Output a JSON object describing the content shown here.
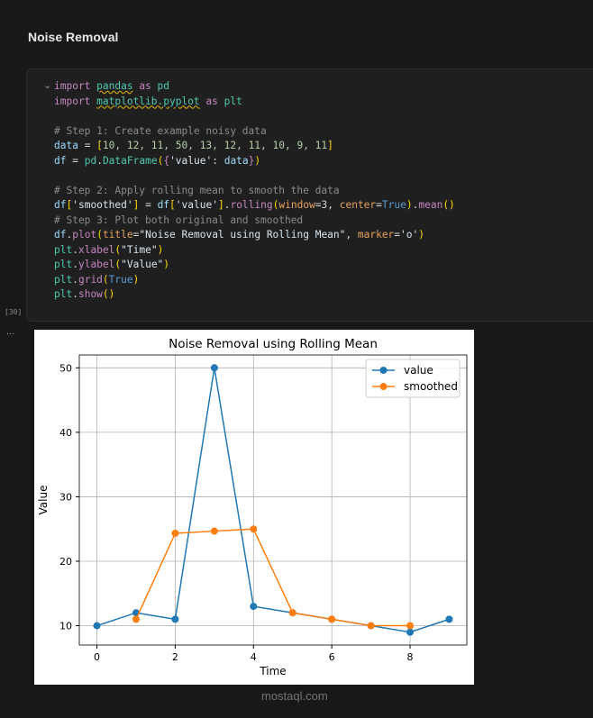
{
  "section_title": "Noise Removal",
  "cell": {
    "execution_count": "[30]",
    "output_prompt": "...",
    "code_lines": [
      [
        {
          "t": "import ",
          "k": "kw"
        },
        {
          "t": "pandas",
          "k": "mod sq"
        },
        {
          "t": " as ",
          "k": "kw"
        },
        {
          "t": "pd",
          "k": "mod"
        }
      ],
      [
        {
          "t": "import ",
          "k": "kw"
        },
        {
          "t": "matplotlib.pyplot",
          "k": "mod sq"
        },
        {
          "t": " as ",
          "k": "kw"
        },
        {
          "t": "plt",
          "k": "mod"
        }
      ],
      [],
      [
        {
          "t": "# Step 1: Create example noisy data",
          "k": "cm"
        }
      ],
      [
        {
          "t": "data",
          "k": "var"
        },
        {
          "t": " = ",
          "k": ""
        },
        {
          "t": "[",
          "k": "br"
        },
        {
          "t": "10, 12, 11, 50, 13, 12, 11, 10, 9, 11",
          "k": "num"
        },
        {
          "t": "]",
          "k": "br"
        }
      ],
      [
        {
          "t": "df",
          "k": "var"
        },
        {
          "t": " = ",
          "k": ""
        },
        {
          "t": "pd",
          "k": "mod"
        },
        {
          "t": ".",
          "k": ""
        },
        {
          "t": "DataFrame",
          "k": "mod"
        },
        {
          "t": "(",
          "k": "br"
        },
        {
          "t": "{",
          "k": "kw"
        },
        {
          "t": "'value'",
          "k": "str"
        },
        {
          "t": ": ",
          "k": ""
        },
        {
          "t": "data",
          "k": "var"
        },
        {
          "t": "}",
          "k": "kw"
        },
        {
          "t": ")",
          "k": "br"
        }
      ],
      [],
      [
        {
          "t": "# Step 2: Apply rolling mean to smooth the data",
          "k": "cm"
        }
      ],
      [
        {
          "t": "df",
          "k": "var"
        },
        {
          "t": "[",
          "k": "br"
        },
        {
          "t": "'smoothed'",
          "k": "str"
        },
        {
          "t": "]",
          "k": "br"
        },
        {
          "t": " = ",
          "k": ""
        },
        {
          "t": "df",
          "k": "var"
        },
        {
          "t": "[",
          "k": "br"
        },
        {
          "t": "'value'",
          "k": "str"
        },
        {
          "t": "]",
          "k": "br"
        },
        {
          "t": ".",
          "k": ""
        },
        {
          "t": "rolling",
          "k": "kw"
        },
        {
          "t": "(",
          "k": "br"
        },
        {
          "t": "window",
          "k": "prm"
        },
        {
          "t": "=3, ",
          "k": ""
        },
        {
          "t": "center",
          "k": "prm"
        },
        {
          "t": "=",
          "k": ""
        },
        {
          "t": "True",
          "k": "bool"
        },
        {
          "t": ")",
          "k": "br"
        },
        {
          "t": ".",
          "k": ""
        },
        {
          "t": "mean",
          "k": "kw"
        },
        {
          "t": "()",
          "k": "br"
        }
      ],
      [
        {
          "t": "# Step 3: Plot both original and smoothed",
          "k": "cm"
        }
      ],
      [
        {
          "t": "df",
          "k": "var"
        },
        {
          "t": ".",
          "k": ""
        },
        {
          "t": "plot",
          "k": "kw"
        },
        {
          "t": "(",
          "k": "br"
        },
        {
          "t": "title",
          "k": "prm"
        },
        {
          "t": "=",
          "k": ""
        },
        {
          "t": "\"Noise Removal using Rolling Mean\"",
          "k": "str"
        },
        {
          "t": ", ",
          "k": ""
        },
        {
          "t": "marker",
          "k": "prm"
        },
        {
          "t": "=",
          "k": ""
        },
        {
          "t": "'o'",
          "k": "str"
        },
        {
          "t": ")",
          "k": "br"
        }
      ],
      [
        {
          "t": "plt",
          "k": "mod"
        },
        {
          "t": ".",
          "k": ""
        },
        {
          "t": "xlabel",
          "k": "kw"
        },
        {
          "t": "(",
          "k": "br"
        },
        {
          "t": "\"Time\"",
          "k": "str"
        },
        {
          "t": ")",
          "k": "br"
        }
      ],
      [
        {
          "t": "plt",
          "k": "mod"
        },
        {
          "t": ".",
          "k": ""
        },
        {
          "t": "ylabel",
          "k": "kw"
        },
        {
          "t": "(",
          "k": "br"
        },
        {
          "t": "\"Value\"",
          "k": "str"
        },
        {
          "t": ")",
          "k": "br"
        }
      ],
      [
        {
          "t": "plt",
          "k": "mod"
        },
        {
          "t": ".",
          "k": ""
        },
        {
          "t": "grid",
          "k": "kw"
        },
        {
          "t": "(",
          "k": "br"
        },
        {
          "t": "True",
          "k": "bool"
        },
        {
          "t": ")",
          "k": "br"
        }
      ],
      [
        {
          "t": "plt",
          "k": "mod"
        },
        {
          "t": ".",
          "k": ""
        },
        {
          "t": "show",
          "k": "kw"
        },
        {
          "t": "()",
          "k": "br"
        }
      ]
    ]
  },
  "chart_data": {
    "type": "line",
    "title": "Noise Removal using Rolling Mean",
    "xlabel": "Time",
    "ylabel": "Value",
    "xlim": [
      -0.45,
      9.45
    ],
    "ylim": [
      7,
      52
    ],
    "xticks": [
      0,
      2,
      4,
      6,
      8
    ],
    "yticks": [
      10,
      20,
      30,
      40,
      50
    ],
    "grid": true,
    "legend": "top-right",
    "series": [
      {
        "name": "value",
        "color": "#1f77b4",
        "x": [
          0,
          1,
          2,
          3,
          4,
          5,
          6,
          7,
          8,
          9
        ],
        "values": [
          10,
          12,
          11,
          50,
          13,
          12,
          11,
          10,
          9,
          11
        ]
      },
      {
        "name": "smoothed",
        "color": "#ff7f0e",
        "x": [
          1,
          2,
          3,
          4,
          5,
          6,
          7,
          8
        ],
        "values": [
          11,
          24.33,
          24.67,
          25,
          12,
          11,
          10,
          10
        ]
      }
    ]
  },
  "watermark": "mostaql.com"
}
